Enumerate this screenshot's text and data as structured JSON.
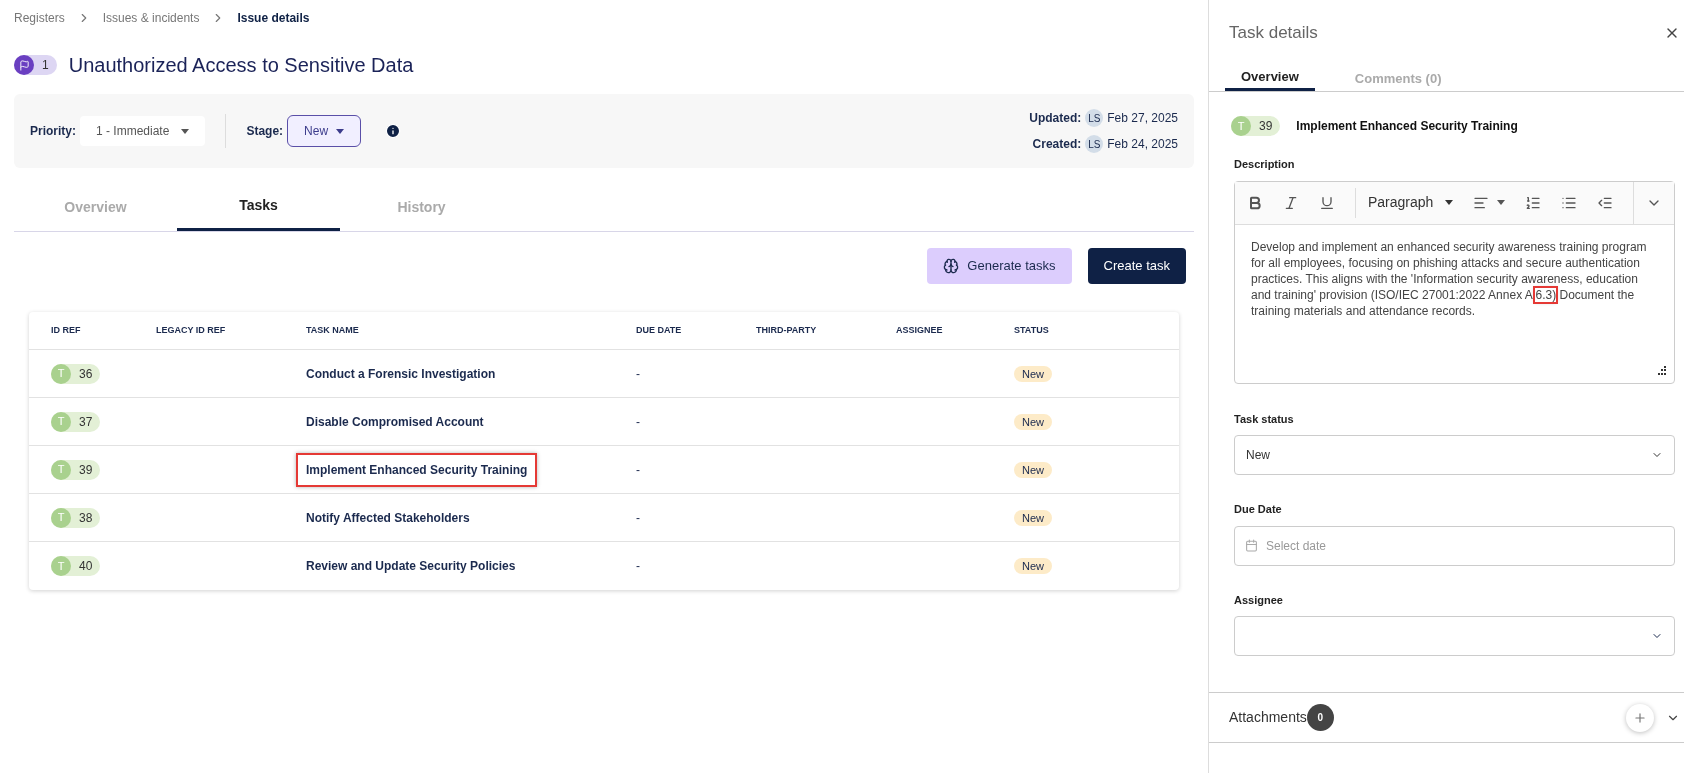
{
  "breadcrumb": [
    {
      "label": "Registers",
      "current": false
    },
    {
      "label": "Issues & incidents",
      "current": false
    },
    {
      "label": "Issue details",
      "current": true
    }
  ],
  "issue": {
    "number": "1",
    "title": "Unauthorized Access to Sensitive Data"
  },
  "meta": {
    "priority_label": "Priority:",
    "priority_value": "1 - Immediate",
    "stage_label": "Stage:",
    "stage_value": "New",
    "updated_label": "Updated:",
    "updated_initials": "LS",
    "updated_date": "Feb 27, 2025",
    "created_label": "Created:",
    "created_initials": "LS",
    "created_date": "Feb 24, 2025"
  },
  "tabs": [
    {
      "label": "Overview",
      "selected": false
    },
    {
      "label": "Tasks",
      "selected": true
    },
    {
      "label": "History",
      "selected": false
    }
  ],
  "actions": {
    "generate": "Generate tasks",
    "create": "Create task"
  },
  "table": {
    "columns": [
      "ID REF",
      "LEGACY ID REF",
      "TASK NAME",
      "DUE DATE",
      "THIRD-PARTY",
      "ASSIGNEE",
      "STATUS"
    ],
    "rows": [
      {
        "prefix": "T",
        "id": "36",
        "name": "Conduct a Forensic Investigation",
        "due": "-",
        "status": "New",
        "highlighted": false
      },
      {
        "prefix": "T",
        "id": "37",
        "name": "Disable Compromised Account",
        "due": "-",
        "status": "New",
        "highlighted": false
      },
      {
        "prefix": "T",
        "id": "39",
        "name": "Implement Enhanced Security Training",
        "due": "-",
        "status": "New",
        "highlighted": true
      },
      {
        "prefix": "T",
        "id": "38",
        "name": "Notify Affected Stakeholders",
        "due": "-",
        "status": "New",
        "highlighted": false
      },
      {
        "prefix": "T",
        "id": "40",
        "name": "Review and Update Security Policies",
        "due": "-",
        "status": "New",
        "highlighted": false
      }
    ]
  },
  "panel": {
    "title": "Task details",
    "tabs": [
      {
        "label": "Overview",
        "selected": true
      },
      {
        "label": "Comments (0)",
        "selected": false
      }
    ],
    "task": {
      "prefix": "T",
      "id": "39",
      "name": "Implement Enhanced Security Training"
    },
    "description_label": "Description",
    "toolbar": {
      "paragraph": "Paragraph"
    },
    "description": [
      {
        "text": "Develop and implement an enhanced security awareness training program for all employees, focusing on phishing attacks and secure authentication practices. This aligns with the 'Information security awareness, education and training' provision (ISO/IEC 27001:2022 Annex A ",
        "highlighted": false
      },
      {
        "text": "6.3)",
        "highlighted": true
      },
      {
        "text": " Document the training materials and attendance records.",
        "highlighted": false
      }
    ],
    "status_label": "Task status",
    "status_value": "New",
    "due_label": "Due Date",
    "due_placeholder": "Select date",
    "assignee_label": "Assignee",
    "attachments_label": "Attachments",
    "attachments_count": "0"
  }
}
